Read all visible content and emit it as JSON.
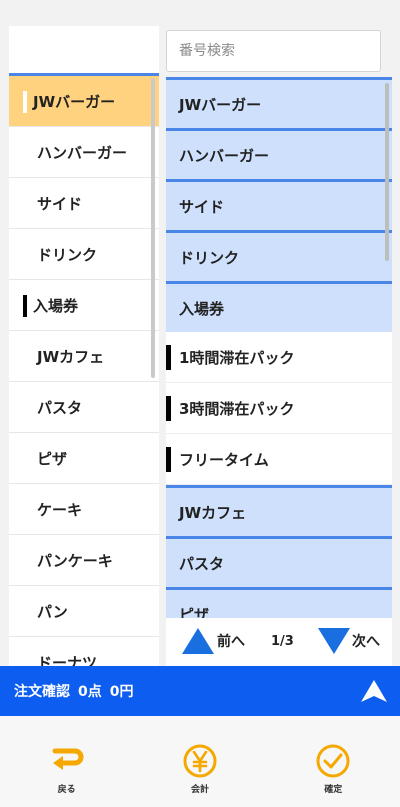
{
  "search": {
    "placeholder": "番号検索"
  },
  "categories": [
    {
      "label": "JWバーガー",
      "active": true,
      "marker": "white"
    },
    {
      "label": "ハンバーガー"
    },
    {
      "label": "サイド"
    },
    {
      "label": "ドリンク"
    },
    {
      "label": "入場券",
      "marker": "black"
    },
    {
      "label": "JWカフェ"
    },
    {
      "label": "パスタ"
    },
    {
      "label": "ピザ"
    },
    {
      "label": "ケーキ"
    },
    {
      "label": "パンケーキ"
    },
    {
      "label": "パン"
    },
    {
      "label": "ドーナツ"
    }
  ],
  "products": [
    {
      "label": "JWバーガー",
      "style": "blue"
    },
    {
      "label": "ハンバーガー",
      "style": "blue"
    },
    {
      "label": "サイド",
      "style": "blue"
    },
    {
      "label": "ドリンク",
      "style": "blue"
    },
    {
      "label": "入場券",
      "style": "blue"
    },
    {
      "label": "1時間滞在パック",
      "style": "white",
      "bar": true
    },
    {
      "label": "3時間滞在パック",
      "style": "white",
      "bar": true
    },
    {
      "label": "フリータイム",
      "style": "white",
      "bar": true
    },
    {
      "label": "JWカフェ",
      "style": "blue"
    },
    {
      "label": "パスタ",
      "style": "blue"
    },
    {
      "label": "ピザ",
      "style": "blue"
    }
  ],
  "pager": {
    "prev_label": "前へ",
    "page": "1/3",
    "next_label": "次へ"
  },
  "order": {
    "title": "注文確認",
    "points": "0点",
    "amount": "0円"
  },
  "nav": {
    "back": "戻る",
    "checkout": "会計",
    "confirm": "確定"
  },
  "colors": {
    "accent_blue": "#0d5ef0",
    "list_blue": "#cfe0fc",
    "active_orange": "#ffd27f",
    "icon_orange": "#f4a800"
  }
}
